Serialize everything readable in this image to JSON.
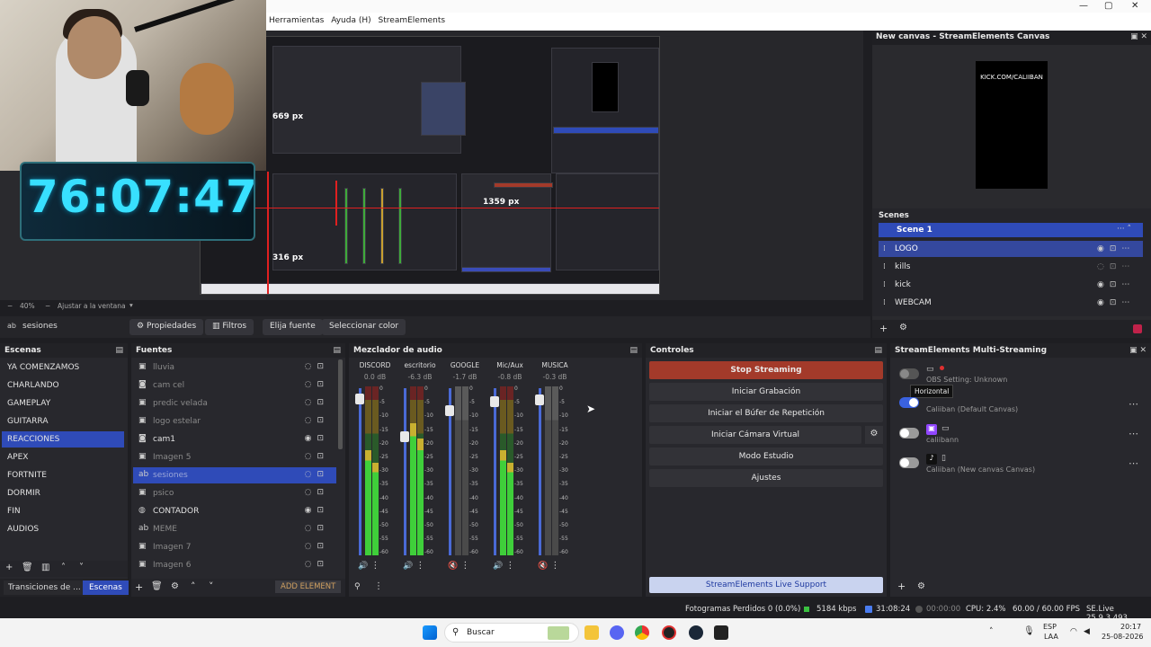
{
  "window": {
    "buttons": [
      "—",
      "▢",
      "✕"
    ]
  },
  "menu": [
    "Herramientas",
    "Ayuda (H)",
    "StreamElements"
  ],
  "preview": {
    "timer": "76:07:47",
    "px_labels": [
      "669 px",
      "1359 px",
      "316 px"
    ],
    "zoom_text": "40%",
    "fit_text": "Ajustar a la ventana"
  },
  "props": {
    "source_name": "sesiones",
    "buttons": [
      "Propiedades",
      "Filtros",
      "Elija fuente",
      "Seleccionar color"
    ]
  },
  "canvas_dock": {
    "title": "New canvas - StreamElements Canvas",
    "canvas_text": "KICK.COM/CALIIBAN",
    "scenes_label": "Scenes",
    "scene_header": "Scene 1",
    "sources": [
      {
        "label": "LOGO",
        "selected": true
      },
      {
        "label": "kills",
        "selected": false
      },
      {
        "label": "kick",
        "selected": false
      },
      {
        "label": "WEBCAM",
        "selected": false
      }
    ]
  },
  "scenes": {
    "title": "Escenas",
    "items": [
      "YA COMENZAMOS",
      "CHARLANDO",
      "GAMEPLAY",
      "GUITARRA",
      "REACCIONES",
      "APEX",
      "FORTNITE",
      "DORMIR",
      "FIN",
      "AUDIOS"
    ],
    "selected_index": 4,
    "tabs": [
      "Transiciones de ...",
      "Escenas"
    ]
  },
  "sources": {
    "title": "Fuentes",
    "items": [
      {
        "label": "lluvia",
        "icon": "image-icon",
        "visible": false
      },
      {
        "label": "cam cel",
        "icon": "camera-icon",
        "visible": false
      },
      {
        "label": "predic velada",
        "icon": "image-icon",
        "visible": false
      },
      {
        "label": "logo estelar",
        "icon": "image-icon",
        "visible": false
      },
      {
        "label": "cam1",
        "icon": "camera-icon",
        "visible": true
      },
      {
        "label": "Imagen 5",
        "icon": "image-icon",
        "visible": false
      },
      {
        "label": "sesiones",
        "icon": "text-icon",
        "visible": false,
        "selected": true
      },
      {
        "label": "psico",
        "icon": "image-icon",
        "visible": false
      },
      {
        "label": "CONTADOR",
        "icon": "browser-icon",
        "visible": true
      },
      {
        "label": "MEME",
        "icon": "text-icon",
        "visible": false
      },
      {
        "label": "Imagen 7",
        "icon": "image-icon",
        "visible": false
      },
      {
        "label": "Imagen 6",
        "icon": "image-icon",
        "visible": false
      }
    ],
    "add_element": "ADD ELEMENT"
  },
  "mixer": {
    "title": "Mezclador de audio",
    "scale": [
      "0",
      "-5",
      "-10",
      "-15",
      "-20",
      "-25",
      "-30",
      "-35",
      "-40",
      "-45",
      "-50",
      "-55",
      "-60"
    ],
    "channels": [
      {
        "name": "DISCORD",
        "db": "0.0 dB",
        "fader": 0.03,
        "level": 0.62,
        "muted": false
      },
      {
        "name": "escritorio",
        "db": "-6.3 dB",
        "fader": 0.26,
        "level": 0.78,
        "muted": false
      },
      {
        "name": "GOOGLE",
        "db": "-1.7 dB",
        "fader": 0.1,
        "level": 0.0,
        "muted": true
      },
      {
        "name": "Mic/Aux",
        "db": "-0.8 dB",
        "fader": 0.05,
        "level": 0.62,
        "muted": false
      },
      {
        "name": "MUSICA",
        "db": "-0.3 dB",
        "fader": 0.04,
        "level": 0.0,
        "muted": true
      }
    ]
  },
  "controls": {
    "title": "Controles",
    "buttons": [
      "Stop Streaming",
      "Iniciar Grabación",
      "Iniciar el Búfer de Repetición",
      "Iniciar Cámara Virtual",
      "Modo Estudio",
      "Ajustes"
    ],
    "support": "StreamElements Live Support"
  },
  "multistream": {
    "title": "StreamElements Multi-Streaming",
    "tooltip": "Horizontal",
    "rows": [
      {
        "text": "OBS Setting: Unknown",
        "on": false
      },
      {
        "text": "Caliiban (Default Canvas)",
        "on": true
      },
      {
        "text": "caliibann",
        "on": false
      },
      {
        "text": "Caliiban (New canvas Canvas)",
        "on": false
      }
    ]
  },
  "status": {
    "dropped": "Fotogramas Perdidos 0 (0.0%)",
    "kbps": "5184 kbps",
    "live_time": "31:08:24",
    "rec_time": "00:00:00",
    "cpu": "CPU: 2.4%",
    "fps": "60.00 / 60.00 FPS",
    "version": "SE.Live 25.9.3.493"
  },
  "taskbar": {
    "search": "Buscar",
    "lang": "ESP",
    "lang2": "LAA",
    "time": "20:17",
    "date": "25-08-2026"
  },
  "colors": {
    "accent": "#2f4bb8",
    "stop": "#a33a2a",
    "timer": "#38e0ff"
  }
}
